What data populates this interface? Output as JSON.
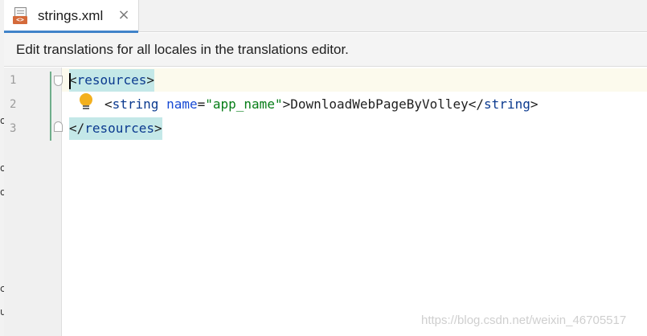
{
  "tab": {
    "filename": "strings.xml",
    "close_glyph": "×",
    "file_badge": "<>"
  },
  "banner": {
    "message": "Edit translations for all locales in the translations editor."
  },
  "editor": {
    "line_numbers": [
      "1",
      "2",
      "3"
    ],
    "lines": {
      "l1": {
        "open": "<",
        "tag": "resources",
        "close": ">"
      },
      "l2": {
        "open": "<",
        "tag": "string",
        "space": " ",
        "attr": "name",
        "eq": "=",
        "value": "\"app_name\"",
        "gt": ">",
        "text": "DownloadWebPageByVolley",
        "end_open": "</",
        "end_tag": "string",
        "end_close": ">"
      },
      "l3": {
        "open": "</",
        "tag": "resources",
        "close": ">"
      }
    }
  },
  "left_edge_fragments": [
    "o",
    "o",
    "o",
    "c",
    "u"
  ],
  "watermark": "https://blog.csdn.net/weixin_46705517",
  "colors": {
    "accent": "#4083c9",
    "tag": "#0b3a8f",
    "attribute": "#174ad4",
    "string": "#067d17",
    "tag_highlight": "#c4e8e8"
  }
}
